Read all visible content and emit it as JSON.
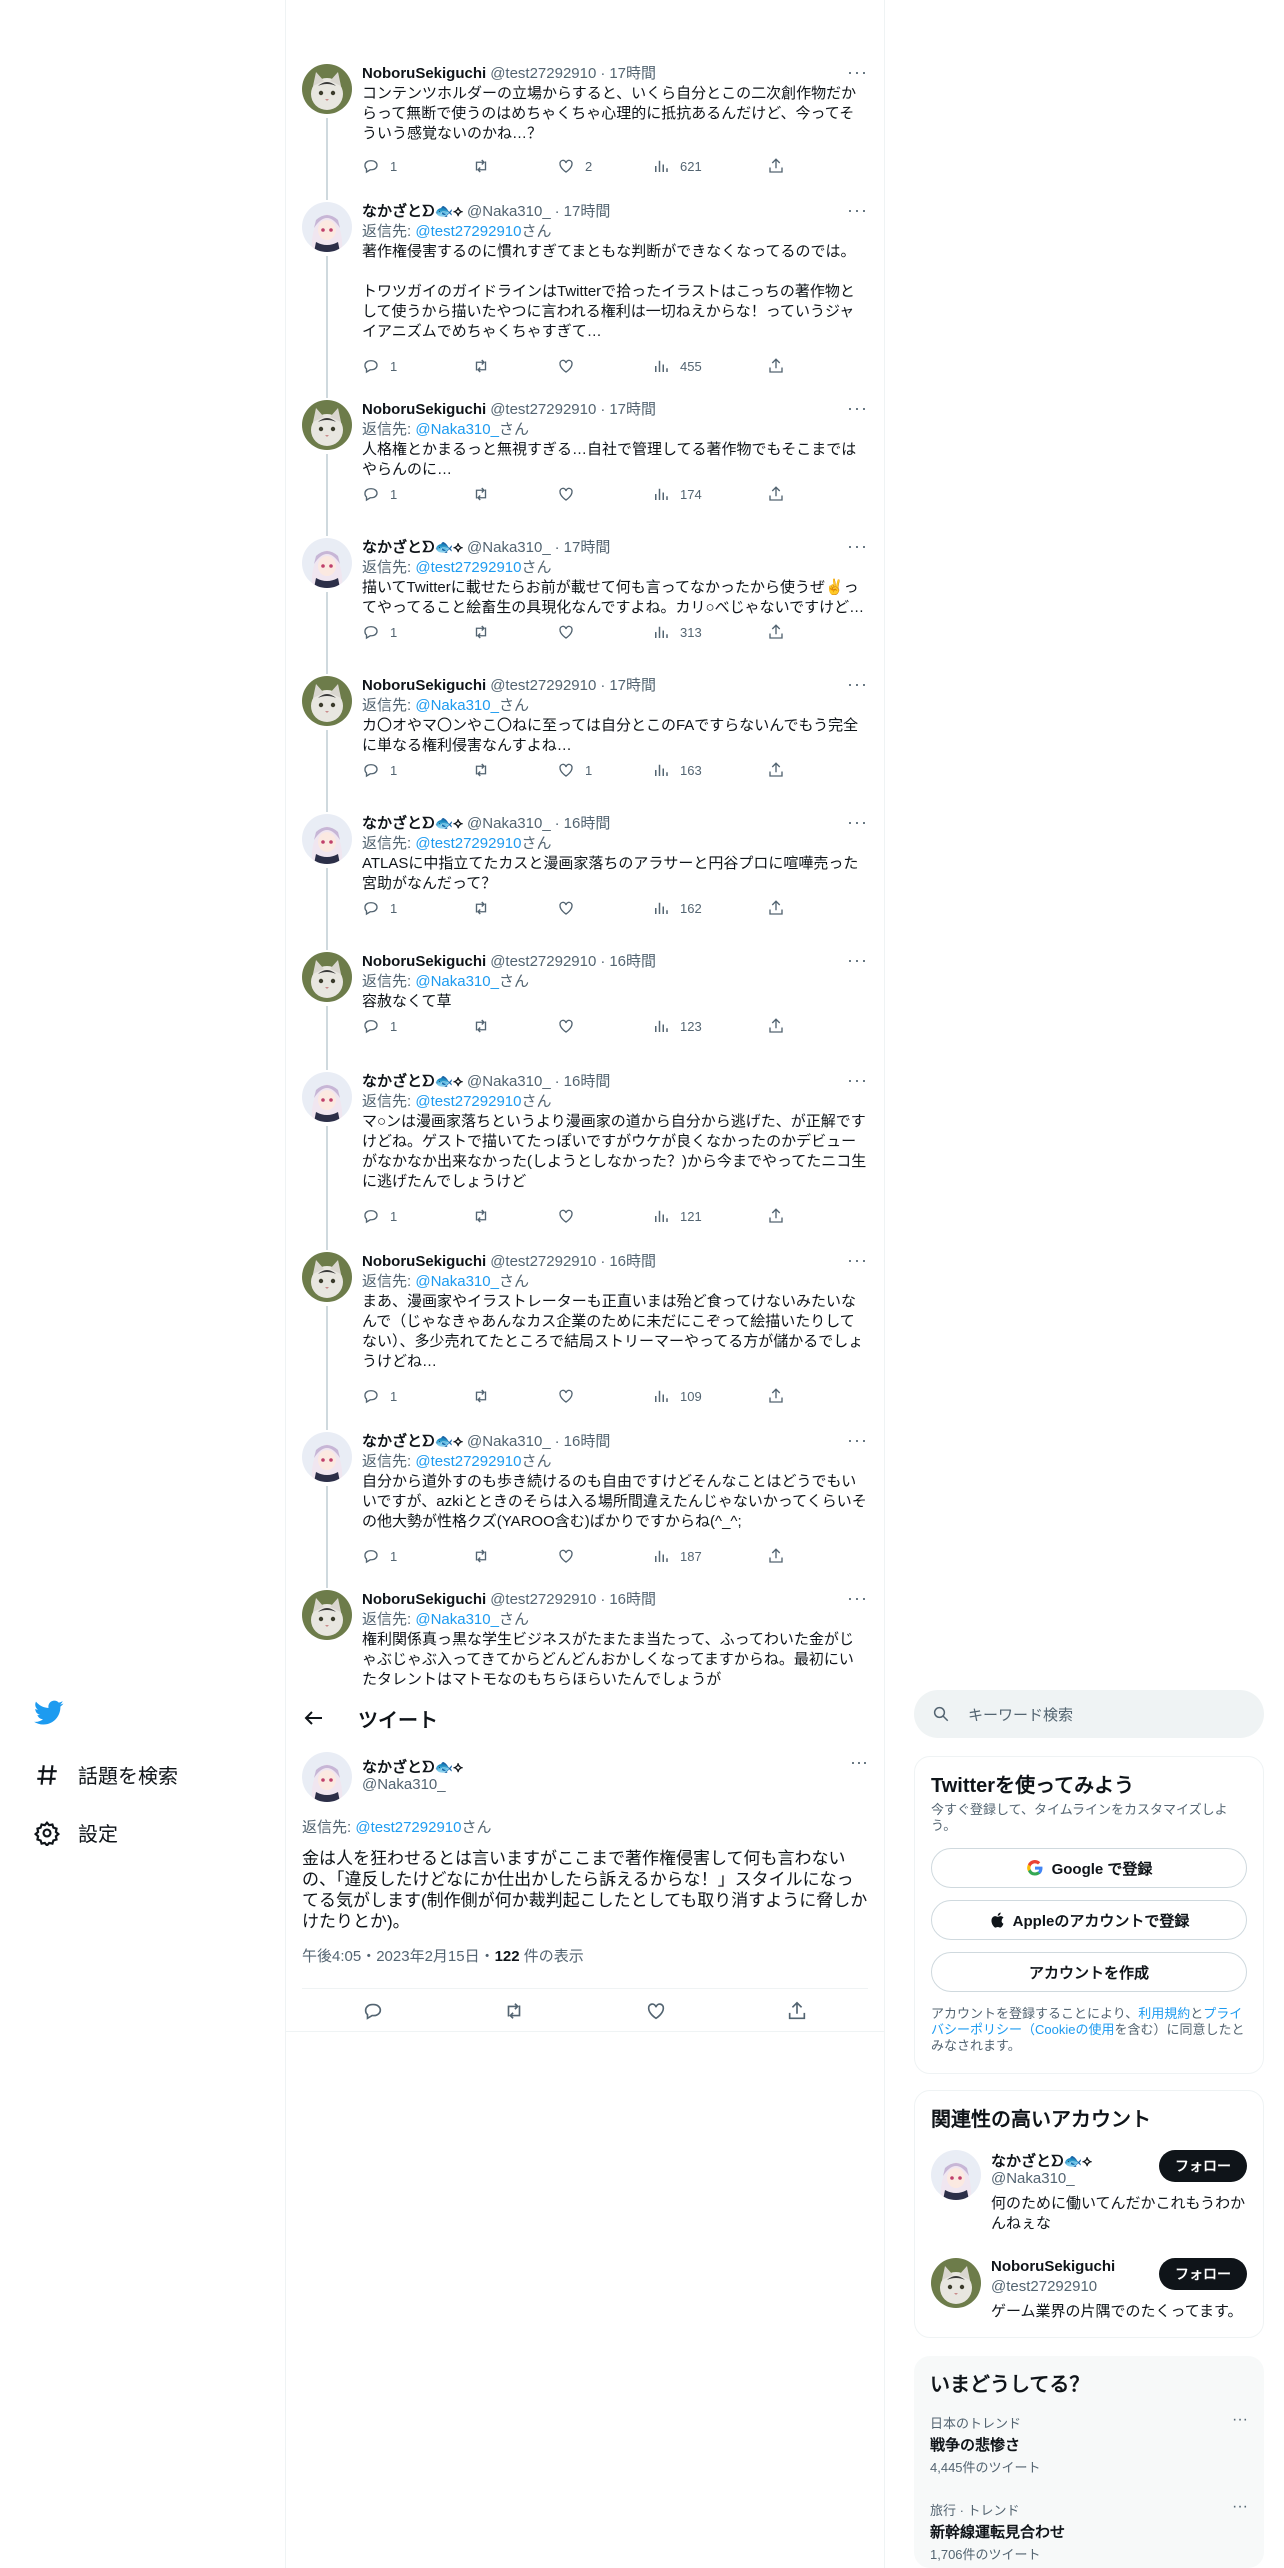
{
  "nav": {
    "items": [
      {
        "label": "話題を検索",
        "icon": "hashtag-icon"
      },
      {
        "label": "設定",
        "icon": "gear-icon"
      }
    ]
  },
  "thread": [
    {
      "name": "NoboruSekiguchi",
      "handle": "@test27292910",
      "time": "17時間",
      "reply_to": "",
      "text": "コンテンツホルダーの立場からすると、いくら自分とこの二次創作物だからって無断で使うのはめちゃくちゃ心理的に抵抗あるんだけど、今ってそういう感覚ないのかね…？",
      "replies": "1",
      "retweets": "",
      "likes": "2",
      "views": "621",
      "avatar": "cat"
    },
    {
      "name": "なかざとᗤ🐟⟡",
      "handle": "@Naka310_",
      "time": "17時間",
      "reply_to": "@test27292910",
      "text": "著作権侵害するのに慣れすぎてまともな判断ができなくなってるのでは。\n\nトワツガイのガイドラインはTwitterで拾ったイラストはこっちの著作物として使うから描いたやつに言われる権利は一切ねえからな！っていうジャイアニズムでめちゃくちゃすぎて…",
      "replies": "1",
      "retweets": "",
      "likes": "",
      "views": "455",
      "avatar": "anime"
    },
    {
      "name": "NoboruSekiguchi",
      "handle": "@test27292910",
      "time": "17時間",
      "reply_to": "@Naka310_",
      "text": "人格権とかまるっと無視すぎる…自社で管理してる著作物でもそこまではやらんのに…",
      "replies": "1",
      "retweets": "",
      "likes": "",
      "views": "174",
      "avatar": "cat"
    },
    {
      "name": "なかざとᗤ🐟⟡",
      "handle": "@Naka310_",
      "time": "17時間",
      "reply_to": "@test27292910",
      "text": "描いてTwitterに載せたらお前が載せて何も言ってなかったから使うぜ✌️ってやってること絵畜生の具現化なんですよね。カリ○べじゃないですけど…",
      "replies": "1",
      "retweets": "",
      "likes": "",
      "views": "313",
      "avatar": "anime"
    },
    {
      "name": "NoboruSekiguchi",
      "handle": "@test27292910",
      "time": "17時間",
      "reply_to": "@Naka310_",
      "text": "カ〇オやマ〇ンやこ〇ねに至っては自分とこのFAですらないんでもう完全に単なる権利侵害なんすよね…",
      "replies": "1",
      "retweets": "",
      "likes": "1",
      "views": "163",
      "avatar": "cat"
    },
    {
      "name": "なかざとᗤ🐟⟡",
      "handle": "@Naka310_",
      "time": "16時間",
      "reply_to": "@test27292910",
      "text": "ATLASに中指立てたカスと漫画家落ちのアラサーと円谷プロに喧嘩売った宮助がなんだって？",
      "replies": "1",
      "retweets": "",
      "likes": "",
      "views": "162",
      "avatar": "anime"
    },
    {
      "name": "NoboruSekiguchi",
      "handle": "@test27292910",
      "time": "16時間",
      "reply_to": "@Naka310_",
      "text": "容赦なくて草",
      "replies": "1",
      "retweets": "",
      "likes": "",
      "views": "123",
      "avatar": "cat"
    },
    {
      "name": "なかざとᗤ🐟⟡",
      "handle": "@Naka310_",
      "time": "16時間",
      "reply_to": "@test27292910",
      "text": "マ○ンは漫画家落ちというより漫画家の道から自分から逃げた、が正解ですけどね。ゲストで描いてたっぽいですがウケが良くなかったのかデビューがなかなか出来なかった(しようとしなかった？)から今までやってたニコ生に逃げたんでしょうけど",
      "replies": "1",
      "retweets": "",
      "likes": "",
      "views": "121",
      "avatar": "anime"
    },
    {
      "name": "NoboruSekiguchi",
      "handle": "@test27292910",
      "time": "16時間",
      "reply_to": "@Naka310_",
      "text": "まあ、漫画家やイラストレーターも正直いまは殆ど食ってけないみたいなんで（じゃなきゃあんなカス企業のために未だにこぞって絵描いたりしてない）、多少売れてたところで結局ストリーマーやってる方が儲かるでしょうけどね…",
      "replies": "1",
      "retweets": "",
      "likes": "",
      "views": "109",
      "avatar": "cat"
    },
    {
      "name": "なかざとᗤ🐟⟡",
      "handle": "@Naka310_",
      "time": "16時間",
      "reply_to": "@test27292910",
      "text": "自分から道外すのも歩き続けるのも自由ですけどそんなことはどうでもいいですが、azkiとときのそらは入る場所間違えたんじゃないかってくらいその他大勢が性格クズ(YAROO含む)ばかりですからね(^_^;",
      "replies": "1",
      "retweets": "",
      "likes": "",
      "views": "187",
      "avatar": "anime"
    },
    {
      "name": "NoboruSekiguchi",
      "handle": "@test27292910",
      "time": "16時間",
      "reply_to": "@Naka310_",
      "text": "権利関係真っ黒な学生ビジネスがたまたま当たって、ふってわいた金がじゃぶじゃぶ入ってきてからどんどんおかしくなってますからね。最初にいたタレントはマトモなのもちらほらいたんでしょうが",
      "replies": "",
      "retweets": "",
      "likes": "",
      "views": "",
      "avatar": "cat"
    }
  ],
  "focal": {
    "header_title": "ツイート",
    "name": "なかざとᗤ🐟⟡",
    "handle": "@Naka310_",
    "reply_label": "返信先: ",
    "reply_to": "@test27292910",
    "reply_suffix": "さん",
    "text": "金は人を狂わせるとは言いますがここまで著作権侵害して何も言わないの、「違反したけどなにか仕出かしたら訴えるからな！」スタイルになってる気がします(制作側が何か裁判起こしたとしても取り消すように脅しかけたりとか)。",
    "time": "午後4:05・2023年2月15日・",
    "views_count": "122",
    "views_label": " 件の表示"
  },
  "reply_prefix": "返信先: ",
  "reply_suffix": "さん",
  "right": {
    "search_placeholder": "キーワード検索",
    "signup": {
      "title": "Twitterを使ってみよう",
      "subtitle": "今すぐ登録して、タイムラインをカスタマイズしよう。",
      "google": "Google で登録",
      "apple": "Appleのアカウントで登録",
      "create": "アカウントを作成",
      "note_prefix": "アカウントを登録することにより、",
      "terms": "利用規約",
      "and": "と",
      "privacy": "プライバシーポリシー（Cookieの使用",
      "note_suffix": "を含む）に同意したとみなされます。"
    },
    "related": {
      "title": "関連性の高いアカウント",
      "accounts": [
        {
          "name": "なかざとᗤ🐟⟡",
          "handle": "@Naka310_",
          "bio": "何のために働いてんだかこれもうわかんねぇな",
          "follow": "フォロー"
        },
        {
          "name": "NoboruSekiguchi",
          "handle": "@test27292910",
          "bio": "ゲーム業界の片隅でのたくってます。",
          "follow": "フォロー"
        }
      ]
    },
    "trends": {
      "title": "いまどうしてる？",
      "items": [
        {
          "category": "日本のトレンド",
          "name": "戦争の悲惨さ",
          "count": "4,445件のツイート"
        },
        {
          "category": "旅行 · トレンド",
          "name": "新幹線運転見合わせ",
          "count": "1,706件のツイート"
        }
      ]
    }
  },
  "colors": {
    "accent": "#1d9bf0",
    "text": "#0f1419",
    "muted": "#536471",
    "border": "#eff3f4"
  }
}
